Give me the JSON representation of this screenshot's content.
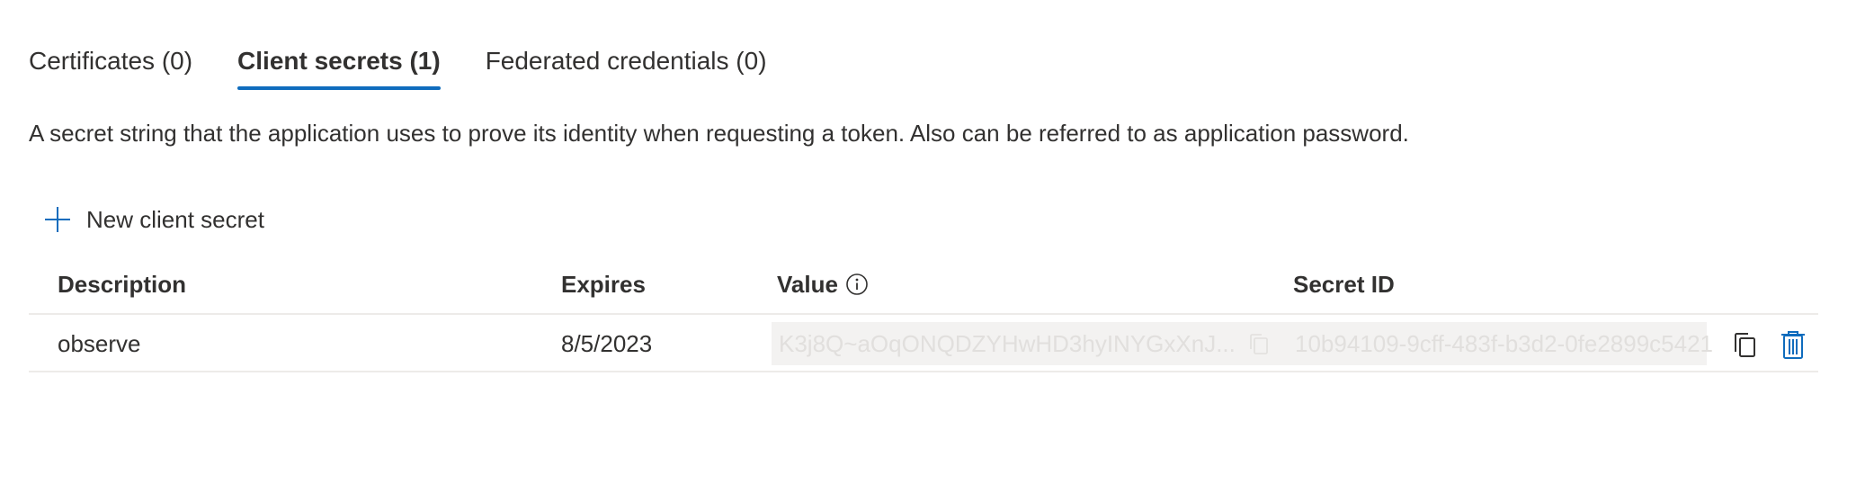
{
  "tabs": [
    {
      "label": "Certificates (0)",
      "active": false
    },
    {
      "label": "Client secrets (1)",
      "active": true
    },
    {
      "label": "Federated credentials (0)",
      "active": false
    }
  ],
  "description": "A secret string that the application uses to prove its identity when requesting a token. Also can be referred to as application password.",
  "new_secret_label": "New client secret",
  "table": {
    "headers": {
      "description": "Description",
      "expires": "Expires",
      "value": "Value",
      "secret_id": "Secret ID"
    },
    "rows": [
      {
        "description": "observe",
        "expires": "8/5/2023",
        "value": "K3j8Q~aOqONQDZYHwHD3hyINYGxXnJ...",
        "secret_id": "10b94109-9cff-483f-b3d2-0fe2899c5421"
      }
    ]
  },
  "icons": {
    "add": "plus-icon",
    "info": "info-icon",
    "copy": "copy-icon",
    "delete": "trash-icon"
  },
  "colors": {
    "accent": "#0f6cbd",
    "text": "#323130",
    "masked_text": "#e1dfdd",
    "masked_bg": "#f3f2f1",
    "divider": "#edebe9"
  }
}
